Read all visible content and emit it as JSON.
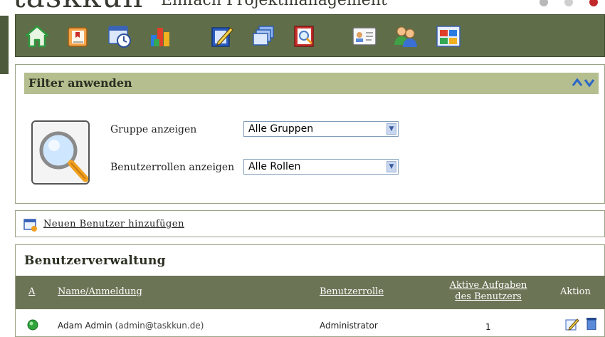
{
  "brand": {
    "logo": "taskkun",
    "tagline": "Einfach Projektmanagement"
  },
  "toolbar": {
    "icons": [
      "home-icon",
      "tasks-icon",
      "calendar-clock-icon",
      "chart-icon",
      "edit-document-icon",
      "windows-icon",
      "search-book-icon",
      "contact-card-icon",
      "users-icon",
      "dashboard-icon"
    ]
  },
  "filter": {
    "title": "Filter anwenden",
    "group_label": "Gruppe anzeigen",
    "group_value": "Alle Gruppen",
    "role_label": "Benutzerrollen anzeigen",
    "role_value": "Alle Rollen"
  },
  "add_user": {
    "label": "Neuen Benutzer hinzufügen"
  },
  "users": {
    "title": "Benutzerverwaltung",
    "columns": {
      "a": "A",
      "name": "Name/Anmeldung",
      "role": "Benutzerrolle",
      "tasks_line1": "Aktive Aufgaben",
      "tasks_line2": "des Benutzers",
      "action": "Aktion"
    },
    "rows": [
      {
        "name": "Adam Admin",
        "login": "(admin@taskkun.de)",
        "role": "Administrator",
        "tasks": "1"
      }
    ]
  },
  "colors": {
    "toolbar_bg": "#5f6e49",
    "filter_head_bg": "#b4be8e",
    "table_head_bg": "#6c7456"
  }
}
